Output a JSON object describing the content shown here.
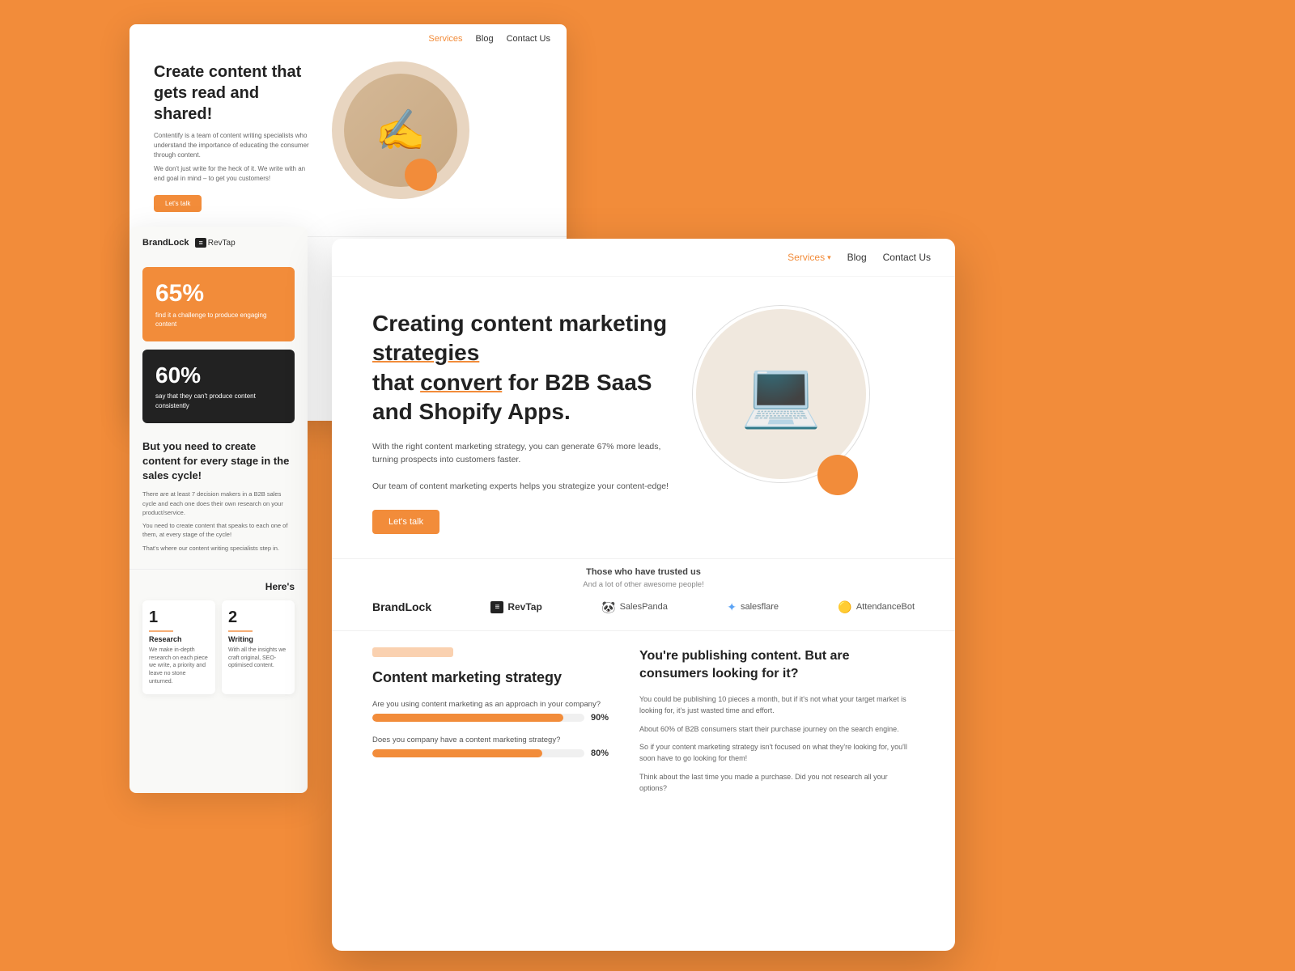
{
  "background": {
    "color": "#F28C3A"
  },
  "card_back": {
    "nav": {
      "services": "Services",
      "blog": "Blog",
      "contact": "Contact Us"
    },
    "hero": {
      "headline": "Create content that gets read",
      "headline_bold": "and shared!",
      "body1": "Contentify is a team of content writing specialists who understand the importance of educating the consumer through content.",
      "body2": "We don't just write for the heck of it. We write with an end goal in mind – to get you customers!",
      "cta": "Let's talk"
    },
    "trusted": "Those who have trusted us"
  },
  "left_panel": {
    "logos": {
      "brandlock": "BrandLock",
      "revtap": "RevTap"
    },
    "stat1": {
      "percent": "65%",
      "desc": "find it a challenge to produce engaging content"
    },
    "stat2": {
      "percent": "60%",
      "desc": "say that they can't produce content consistently"
    },
    "section": {
      "title": "But you need to create content for every stage in the sales cycle!",
      "body1": "There are at least 7 decision makers in a B2B sales cycle and each one does their own research on your product/service.",
      "body2": "You need to create content that speaks to each one of them, at every stage of the cycle!",
      "body3": "That's where our content writing specialists step in."
    },
    "heres": {
      "title": "Here's",
      "step1": {
        "num": "1",
        "title": "Research",
        "desc": "We make in-depth research on each piece we write, a priority and leave no stone unturned."
      },
      "step2": {
        "num": "2",
        "title": "Writing",
        "desc": "With all the insights we craft original, SEO-optimised content."
      }
    }
  },
  "card_front": {
    "nav": {
      "services": "Services",
      "blog": "Blog",
      "contact": "Contact Us"
    },
    "hero": {
      "headline_part1": "Creating content marketing",
      "headline_underline": "strategies",
      "headline_part2": "that",
      "headline_convert": "convert",
      "headline_part3": "for B2B SaaS and Shopify Apps.",
      "body1": "With the right content marketing strategy, you can generate 67% more leads, turning prospects into customers faster.",
      "body2": "Our team of content marketing experts helps you strategize your content-edge!",
      "cta": "Let's talk"
    },
    "trusted": {
      "title": "Those who have trusted us",
      "subtitle": "And a lot of other awesome people!",
      "logos": {
        "brandlock": "BrandLock",
        "revtap": "RevTap",
        "salespanda": "SalesPanda",
        "salesflare": "salesflare",
        "attendancebot": "AttendanceBot"
      }
    },
    "content_section": {
      "left": {
        "title": "Content marketing strategy",
        "stat1": {
          "question": "Are you using content marketing as an approach in your company?",
          "percent": "90%",
          "fill": 90
        },
        "stat2": {
          "question": "Does you company have a content marketing strategy?",
          "percent": "80%",
          "fill": 80
        }
      },
      "right": {
        "title": "You're publishing content. But are consumers looking for it?",
        "body1": "You could be publishing 10 pieces a month, but if it's not what your target market is looking for, it's just wasted time and effort.",
        "body2": "About 60% of B2B consumers start their purchase journey on the search engine.",
        "body3": "So if your content marketing strategy isn't focused on what they're looking for, you'll soon have to go looking for them!",
        "body4": "Think about the last time you made a purchase. Did you not research all your options?"
      }
    }
  }
}
